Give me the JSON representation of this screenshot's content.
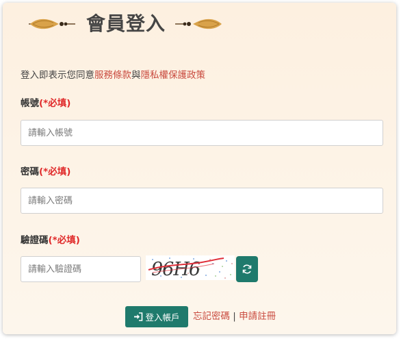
{
  "header": {
    "title": "會員登入"
  },
  "notice": {
    "prefix": "登入即表示您同意",
    "terms_link": "服務條款",
    "joiner": "與",
    "privacy_link": "隱私權保護政策"
  },
  "account": {
    "label": "帳號",
    "required": "(*必填)",
    "placeholder": "請輸入帳號"
  },
  "password": {
    "label": "密碼",
    "required": "(*必填)",
    "placeholder": "請輸入密碼"
  },
  "captcha": {
    "label": "驗證碼",
    "required": "(*必填)",
    "placeholder": "請輸入驗證碼",
    "code": "96H6",
    "refresh_icon": "refresh-icon"
  },
  "actions": {
    "login_label": "登入帳戶",
    "login_icon": "sign-in-icon",
    "forgot_link": "忘記密碼",
    "separator": "|",
    "register_link": "申請註冊"
  },
  "colors": {
    "accent": "#1f7a6c",
    "link": "#c94a3e",
    "required": "#e02a2a"
  }
}
